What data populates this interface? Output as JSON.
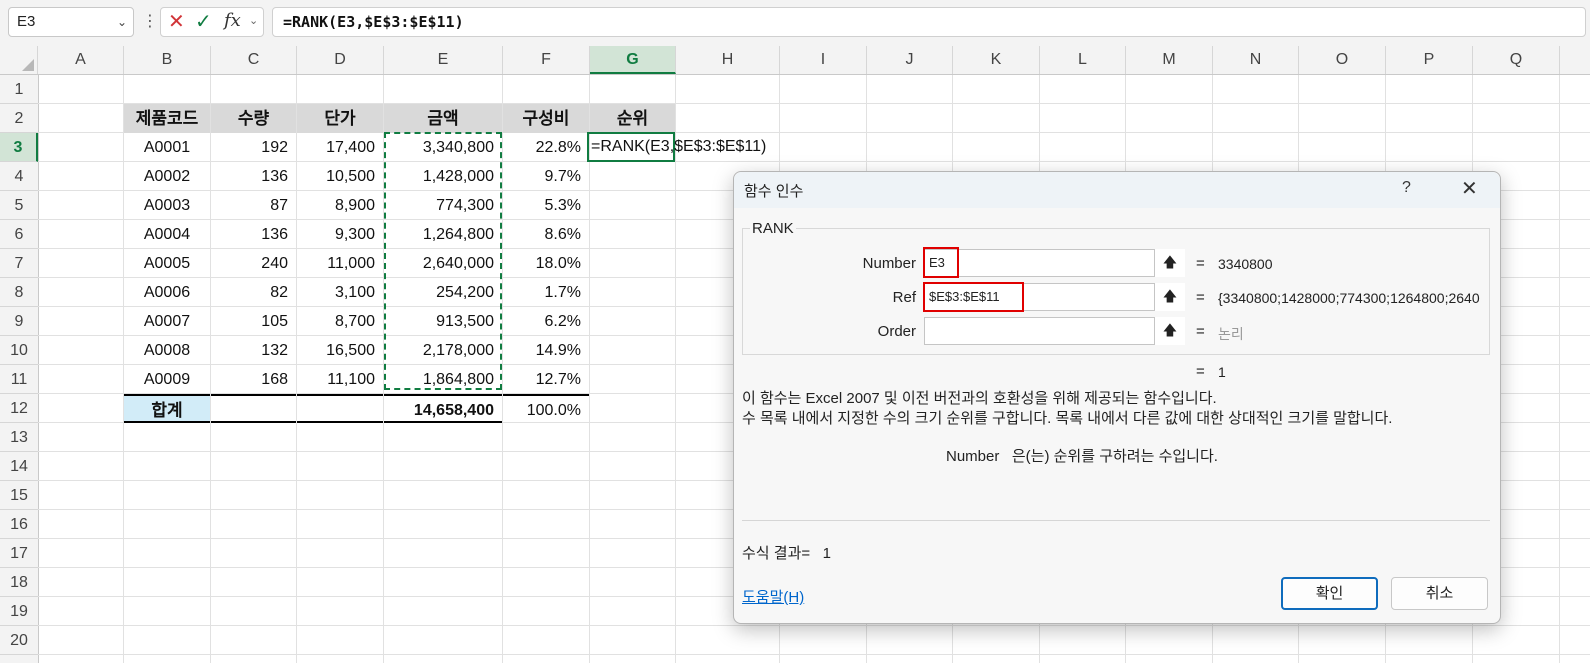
{
  "formula_bar": {
    "name_box": "E3",
    "formula": "=RANK(E3,$E$3:$E$11)"
  },
  "columns": [
    "A",
    "B",
    "C",
    "D",
    "E",
    "F",
    "G",
    "H",
    "I",
    "J",
    "K",
    "L",
    "M",
    "N",
    "O",
    "P",
    "Q"
  ],
  "rows": [
    "1",
    "2",
    "3",
    "4",
    "5",
    "6",
    "7",
    "8",
    "9",
    "10",
    "11",
    "12",
    "13",
    "14",
    "15",
    "16",
    "17",
    "18",
    "19",
    "20"
  ],
  "table": {
    "headers": [
      "제품코드",
      "수량",
      "단가",
      "금액",
      "구성비",
      "순위"
    ],
    "rows": [
      [
        "A0001",
        "192",
        "17,400",
        "3,340,800",
        "22.8%"
      ],
      [
        "A0002",
        "136",
        "10,500",
        "1,428,000",
        "9.7%"
      ],
      [
        "A0003",
        "87",
        "8,900",
        "774,300",
        "5.3%"
      ],
      [
        "A0004",
        "136",
        "9,300",
        "1,264,800",
        "8.6%"
      ],
      [
        "A0005",
        "240",
        "11,000",
        "2,640,000",
        "18.0%"
      ],
      [
        "A0006",
        "82",
        "3,100",
        "254,200",
        "1.7%"
      ],
      [
        "A0007",
        "105",
        "8,700",
        "913,500",
        "6.2%"
      ],
      [
        "A0008",
        "132",
        "16,500",
        "2,178,000",
        "14.9%"
      ],
      [
        "A0009",
        "168",
        "11,100",
        "1,864,800",
        "12.7%"
      ]
    ],
    "total_label": "합계",
    "total_amount": "14,658,400",
    "total_ratio": "100.0%",
    "editing_formula": "=RANK(E3,$E$3:$E$11)"
  },
  "dialog": {
    "title": "함수 인수",
    "help_glyph": "?",
    "close_glyph": "✕",
    "function_name": "RANK",
    "args": [
      {
        "label": "Number",
        "value": "E3",
        "result": "3340800"
      },
      {
        "label": "Ref",
        "value": "$E$3:$E$11",
        "result": "{3340800;1428000;774300;1264800;2640"
      },
      {
        "label": "Order",
        "value": "",
        "result": "논리"
      }
    ],
    "overall_result": "1",
    "description_1": "이 함수는 Excel 2007 및 이전 버전과의 호환성을 위해 제공되는 함수입니다.",
    "description_2": "수 목록 내에서 지정한 수의 크기 순위를 구합니다. 목록 내에서 다른 값에 대한 상대적인 크기를 말합니다.",
    "arg_name": "Number",
    "arg_description": "은(는) 순위를 구하려는 수입니다.",
    "formula_result_label": "수식 결과=",
    "formula_result_value": "1",
    "help_link": "도움말(H)",
    "ok_label": "확인",
    "cancel_label": "취소"
  },
  "colors": {
    "accent": "#107c41",
    "header_fill": "#d9d9d9",
    "total_fill": "#d2ecf8",
    "highlight": "#e00000"
  }
}
